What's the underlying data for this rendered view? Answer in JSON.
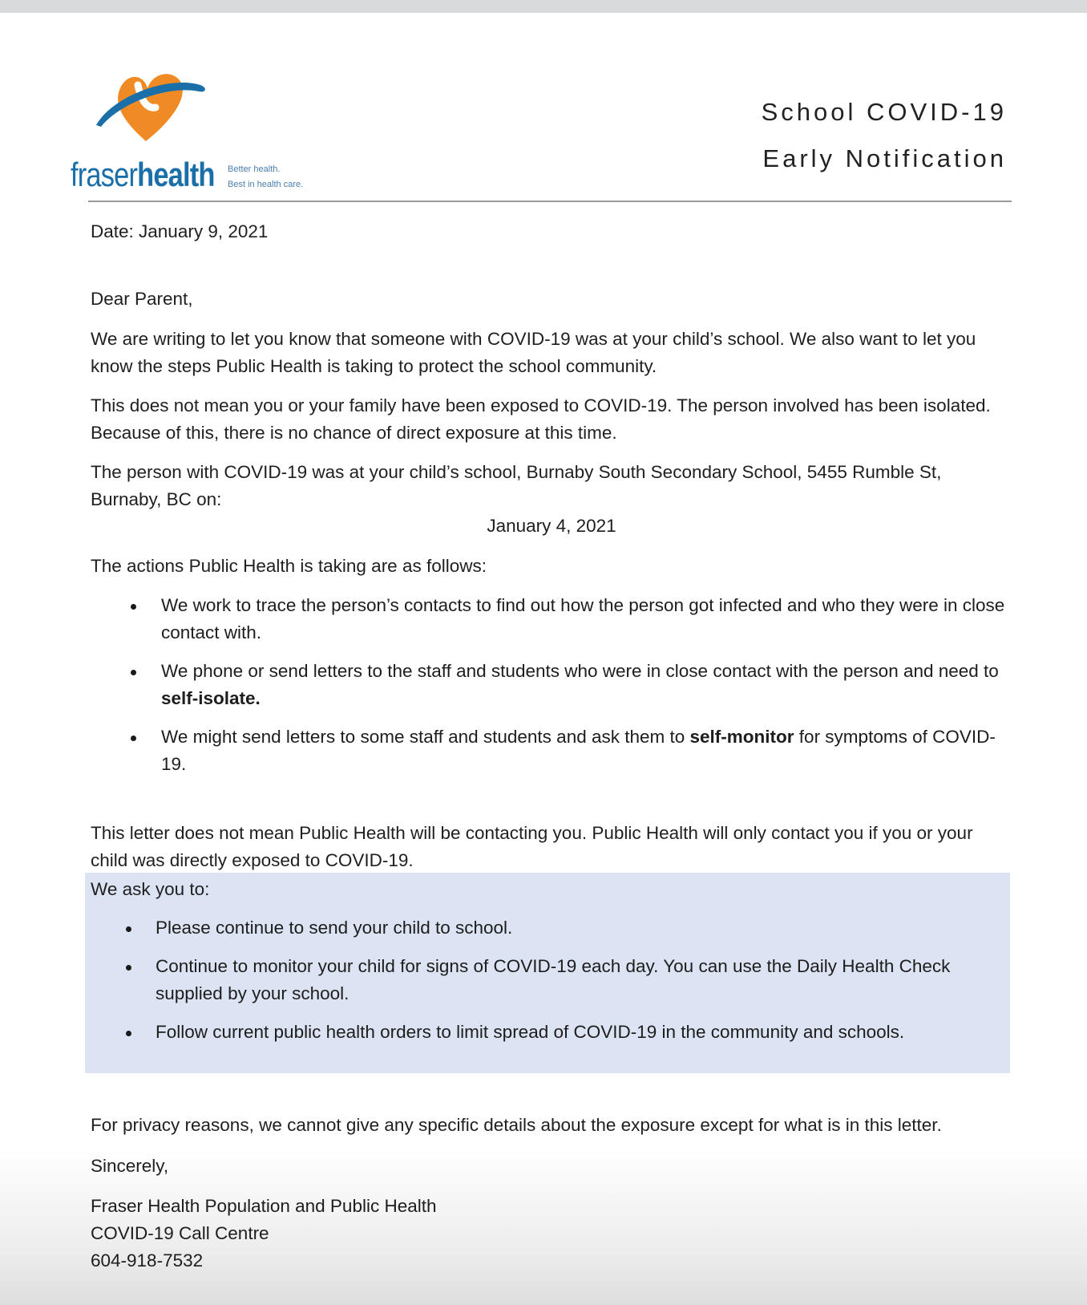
{
  "header": {
    "logo_word_light": "fraser",
    "logo_word_bold": "health",
    "logo_tagline_1": "Better health.",
    "logo_tagline_2": "Best in health care.",
    "title_line_1": "School COVID-19",
    "title_line_2": "Early Notification",
    "colors": {
      "logo_orange": "#f08a24",
      "logo_blue": "#1b6fa8"
    }
  },
  "letter": {
    "date": "Date: January 9, 2021",
    "salutation": "Dear Parent,",
    "para_1": "We are writing to let you know that someone with COVID-19 was at your child’s school. We also want to let you know the steps Public Health is taking to protect the school community.",
    "para_2": "This does not mean you or your family have been exposed to COVID-19. The person involved has been isolated. Because of this, there is no chance of direct exposure at this time.",
    "para_3": "The person with COVID-19 was at your child’s school, Burnaby South Secondary School, 5455 Rumble St, Burnaby, BC on:",
    "exposure_date": "January 4, 2021",
    "actions_intro": "The actions Public Health is taking are as follows:",
    "actions": {
      "item_1": "We work to trace the person’s contacts to find out how the person got infected and who they were in close contact with.",
      "item_2_text": "We phone or send letters to the staff and students who were in close contact with the person and need to ",
      "item_2_bold": "self-isolate.",
      "item_3_text_a": "We might send letters to some staff and students and ask them to ",
      "item_3_bold": "self-monitor",
      "item_3_text_b": " for symptoms of COVID-19."
    },
    "para_4": "This letter does not mean Public Health will be contacting you. Public Health will only contact you if you or your child was directly exposed to COVID-19.",
    "ask": {
      "intro": "We ask you to:",
      "item_1": "Please continue to send your child to school.",
      "item_2": "Continue to monitor your child for signs of COVID-19 each day.  You can use the Daily Health Check supplied by your school.",
      "item_3": "Follow current public health orders to limit spread of COVID-19 in the community and schools.",
      "box_color": "#dce3f2"
    },
    "privacy": "For privacy reasons, we cannot give any specific details about the exposure except for what is in this letter.",
    "closing": "Sincerely,",
    "signature": {
      "line_1": "Fraser Health Population and Public Health",
      "line_2": "COVID-19 Call Centre",
      "line_3": "604-918-7532"
    }
  }
}
